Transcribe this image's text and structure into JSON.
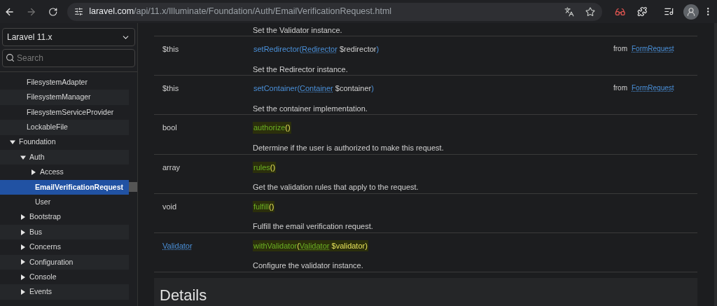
{
  "browser": {
    "url_host": "laravel.com",
    "url_path": "/api/11.x/Illuminate/Foundation/Auth/EmailVerificationRequest.html",
    "forward_disabled": true
  },
  "sidebar": {
    "version_select": "Laravel 11.x",
    "search": {
      "placeholder": "Search"
    },
    "tree": [
      {
        "label": "FilesystemAdapter",
        "selected": false
      },
      {
        "label": "FilesystemManager",
        "selected": false
      },
      {
        "label": "FilesystemServiceProvider",
        "selected": false
      },
      {
        "label": "LockableFile",
        "selected": false
      },
      {
        "label": "Foundation",
        "selected": false,
        "expanded": true,
        "children": [
          {
            "label": "Auth",
            "selected": false,
            "expanded": true,
            "children": [
              {
                "label": "Access",
                "selected": false,
                "expanded": false
              },
              {
                "label": "EmailVerificationRequest",
                "selected": true
              },
              {
                "label": "User",
                "selected": false
              }
            ]
          },
          {
            "label": "Bootstrap",
            "selected": false,
            "expanded": false
          },
          {
            "label": "Bus",
            "selected": false,
            "expanded": false
          },
          {
            "label": "Concerns",
            "selected": false,
            "expanded": false
          },
          {
            "label": "Configuration",
            "selected": false,
            "expanded": false
          },
          {
            "label": "Console",
            "selected": false,
            "expanded": false
          },
          {
            "label": "Events",
            "selected": false,
            "expanded": false
          }
        ]
      }
    ]
  },
  "methods": {
    "leading_description": "Set the Validator instance.",
    "rows": [
      {
        "return_type": "$this",
        "return_is_link": false,
        "highlighted": false,
        "signature": [
          {
            "kind": "name",
            "text": "setRedirector"
          },
          {
            "kind": "punct",
            "text": "("
          },
          {
            "kind": "type",
            "text": "Redirector"
          },
          {
            "kind": "var",
            "text": " $redirector"
          },
          {
            "kind": "punct",
            "text": ")"
          }
        ],
        "description": "Set the Redirector instance.",
        "from_label": "from",
        "from_link": "FormRequest"
      },
      {
        "return_type": "$this",
        "return_is_link": false,
        "highlighted": false,
        "signature": [
          {
            "kind": "name",
            "text": "setContainer"
          },
          {
            "kind": "punct",
            "text": "("
          },
          {
            "kind": "type",
            "text": "Container"
          },
          {
            "kind": "var",
            "text": " $container"
          },
          {
            "kind": "punct",
            "text": ")"
          }
        ],
        "description": "Set the container implementation.",
        "from_label": "from",
        "from_link": "FormRequest"
      },
      {
        "return_type": "bool",
        "return_is_link": false,
        "highlighted": true,
        "signature": [
          {
            "kind": "name",
            "text": "authorize"
          },
          {
            "kind": "punct",
            "text": "()"
          }
        ],
        "description": "Determine if the user is authorized to make this request."
      },
      {
        "return_type": "array",
        "return_is_link": false,
        "highlighted": true,
        "signature": [
          {
            "kind": "name",
            "text": "rules"
          },
          {
            "kind": "punct",
            "text": "()"
          }
        ],
        "description": "Get the validation rules that apply to the request."
      },
      {
        "return_type": "void",
        "return_is_link": false,
        "highlighted": true,
        "signature": [
          {
            "kind": "name",
            "text": "fulfill"
          },
          {
            "kind": "punct",
            "text": "()"
          }
        ],
        "description": "Fulfill the email verification request."
      },
      {
        "return_type": "Validator",
        "return_is_link": true,
        "highlighted": true,
        "signature": [
          {
            "kind": "name",
            "text": "withValidator"
          },
          {
            "kind": "punct",
            "text": "("
          },
          {
            "kind": "type",
            "text": "Validator"
          },
          {
            "kind": "var",
            "text": " $validator"
          },
          {
            "kind": "punct",
            "text": ")"
          }
        ],
        "description": "Configure the validator instance."
      }
    ]
  },
  "details": {
    "heading": "Details"
  }
}
